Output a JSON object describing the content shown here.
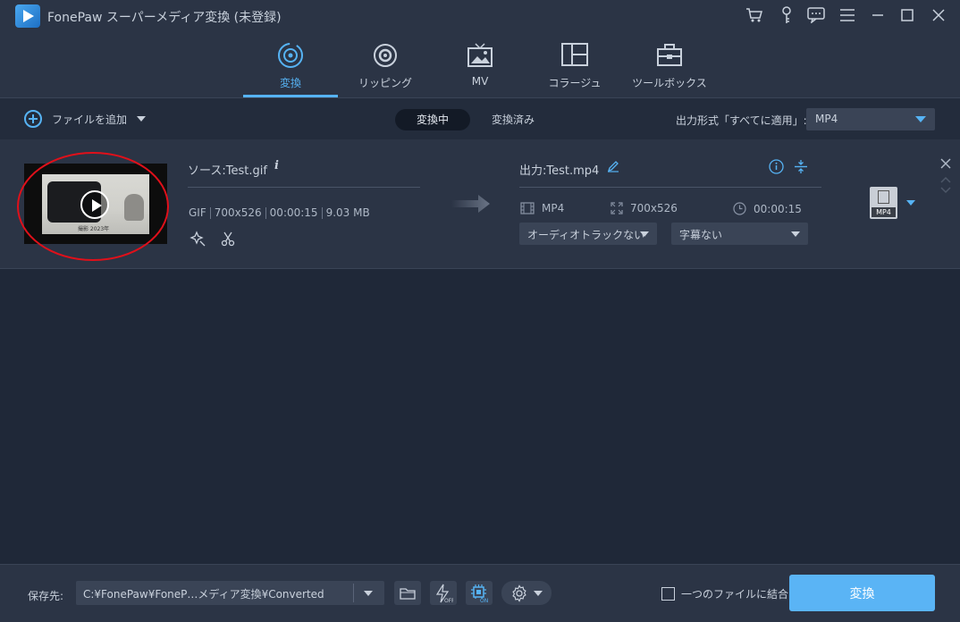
{
  "app": {
    "title": "FonePaw スーパーメディア変換 (未登録)"
  },
  "titlebar_icons": [
    "cart-icon",
    "key-icon",
    "chat-icon",
    "menu-icon",
    "minimize-icon",
    "maximize-icon",
    "close-icon"
  ],
  "nav": {
    "tabs": [
      {
        "label": "変換",
        "icon": "convert-icon",
        "active": true
      },
      {
        "label": "リッピング",
        "icon": "ripper-icon",
        "active": false
      },
      {
        "label": "MV",
        "icon": "mv-icon",
        "active": false
      },
      {
        "label": "コラージュ",
        "icon": "collage-icon",
        "active": false
      },
      {
        "label": "ツールボックス",
        "icon": "toolbox-icon",
        "active": false
      }
    ]
  },
  "toolbar": {
    "add_file": "ファイルを追加",
    "segments": [
      "変換中",
      "変換済み"
    ],
    "active_segment": "変換中",
    "output_format_label": "出力形式「すべてに適用」:",
    "output_format_value": "MP4"
  },
  "file": {
    "source_name": "ソース:Test.gif",
    "source_meta": [
      "GIF",
      "700x526",
      "00:00:15",
      "9.03 MB"
    ],
    "thumbnail_caption": "撮影  2023年",
    "output_name": "出力:Test.mp4",
    "output_format": "MP4",
    "output_resolution": "700x526",
    "output_duration": "00:00:15",
    "audio_track": "オーディオトラックない",
    "subtitle": "字幕ない",
    "format_badge": "MP4"
  },
  "bottom": {
    "save_label": "保存先:",
    "save_path": "C:¥FonePaw¥FoneP…メディア変換¥Converted",
    "merge_label": "一つのファイルに結合",
    "convert_button": "変換"
  },
  "colors": {
    "accent": "#56b3f4",
    "background": "#1f2838",
    "panel": "#2b3445",
    "convert_button": "#5ab4f5",
    "highlight_ellipse": "#e0101a"
  }
}
